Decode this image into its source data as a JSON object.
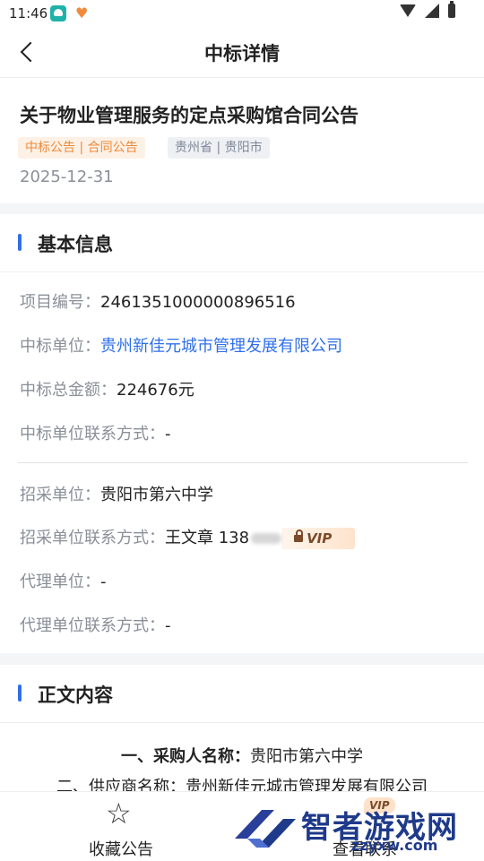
{
  "status_bar": {
    "time": "11:46"
  },
  "nav": {
    "title": "中标详情"
  },
  "notice": {
    "title": "关于物业管理服务的定点采购馆合同公告",
    "tag_type": "中标公告 | 合同公告",
    "tag_region": "贵州省 | 贵阳市",
    "date": "2025-12-31"
  },
  "basic_info": {
    "section_title": "基本信息",
    "project_no_label": "项目编号：",
    "project_no": "2461351000000896516",
    "winner_label": "中标单位：",
    "winner": "贵州新佳元城市管理发展有限公司",
    "amount_label": "中标总金额：",
    "amount": "224676元",
    "winner_contact_label": "中标单位联系方式：",
    "winner_contact": "-",
    "buyer_label": "招采单位：",
    "buyer": "贵阳市第六中学",
    "buyer_contact_label": "招采单位联系方式：",
    "buyer_contact": "王文章 138",
    "vip_label": "VIP",
    "agent_label": "代理单位：",
    "agent": "-",
    "agent_contact_label": "代理单位联系方式：",
    "agent_contact": "-"
  },
  "content": {
    "section_title": "正文内容",
    "line1_label": "一、采购人名称：",
    "line1_value": "贵阳市第六中学",
    "line2_label": "二、供应商名称：",
    "line2_value": "贵州新佳元城市管理发展有限公司"
  },
  "bottom_bar": {
    "favorite_label": "收藏公告",
    "contact_label": "查看联系",
    "vip_label": "VIP"
  },
  "watermark": {
    "text": "智者游戏网",
    "url": "zzyxw.com"
  },
  "colors": {
    "accent": "#2f6fe8",
    "tag_orange": "#ee8a3a",
    "vip_brown": "#7a4a2a"
  }
}
